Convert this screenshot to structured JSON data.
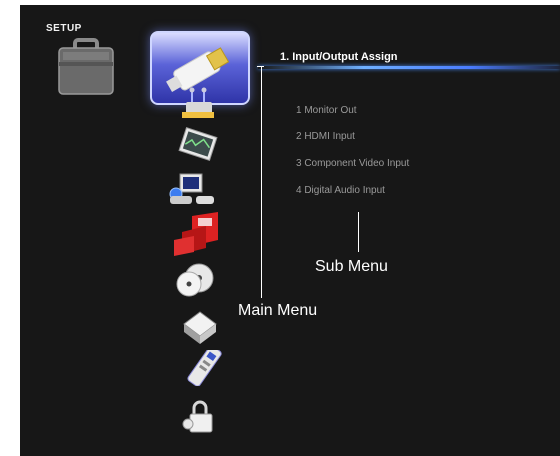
{
  "header": {
    "title": "SETUP",
    "icon": "toolbox-icon"
  },
  "main_menu": {
    "items": [
      {
        "icon": "hdmi-plug-icon",
        "selected": true
      },
      {
        "icon": "network-icon"
      },
      {
        "icon": "display-icon"
      },
      {
        "icon": "video-game-icon"
      },
      {
        "icon": "speaker-icon"
      },
      {
        "icon": "discs-icon"
      },
      {
        "icon": "cube-icon"
      },
      {
        "icon": "remote-control-icon"
      },
      {
        "icon": "lock-icon"
      }
    ]
  },
  "content": {
    "title": "1. Input/Output Assign",
    "items": [
      "1  Monitor Out",
      "2  HDMI Input",
      "3  Component Video Input",
      "4  Digital Audio Input"
    ]
  },
  "annotations": {
    "main_menu_label": "Main Menu",
    "sub_menu_label": "Sub Menu"
  },
  "colors": {
    "background": "#171717",
    "selection": "#3a40c0",
    "accent_bar": "#6fb0ff"
  }
}
